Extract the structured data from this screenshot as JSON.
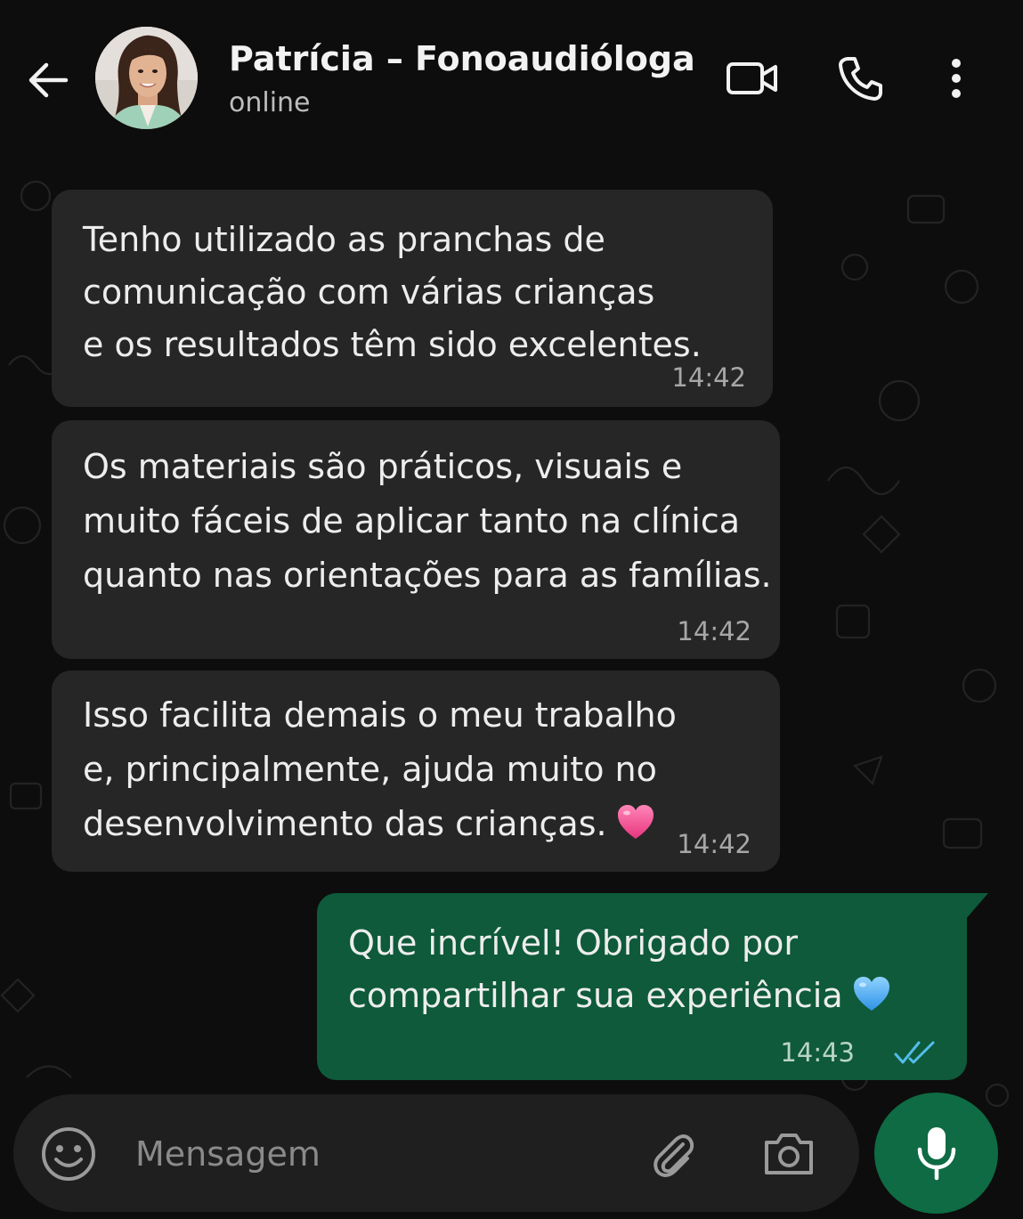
{
  "header": {
    "contact_name": "Patrícia – Fonoaudióloga",
    "status": "online",
    "icons": [
      "back-arrow-icon",
      "video-call-icon",
      "phone-icon",
      "more-vertical-icon"
    ]
  },
  "messages": [
    {
      "direction": "incoming",
      "lines": [
        "Tenho utilizado as pranchas de",
        "comunicação com várias crianças",
        "e os resultados têm sido excelentes."
      ],
      "time": "14:42"
    },
    {
      "direction": "incoming",
      "lines": [
        "Os materiais são práticos, visuais e",
        "muito fáceis de aplicar tanto na clínica",
        "quanto nas orientações para as famílias."
      ],
      "time": "14:42"
    },
    {
      "direction": "incoming",
      "lines": [
        "Isso facilita demais o meu trabalho",
        "e, principalmente, ajuda muito no",
        "desenvolvimento das crianças."
      ],
      "emoji": "pink-heart-emoji",
      "time": "14:42"
    },
    {
      "direction": "outgoing",
      "lines": [
        "Que incrível! Obrigado por",
        "compartilhar sua experiência"
      ],
      "emoji": "blue-heart-emoji",
      "time": "14:43",
      "read_status": "read"
    }
  ],
  "composer": {
    "placeholder": "Mensagem",
    "value": "",
    "icons": [
      "emoji-icon",
      "paperclip-icon",
      "camera-icon",
      "microphone-icon"
    ]
  },
  "colors": {
    "background": "#0d0d0d",
    "incoming_bubble": "#262626",
    "outgoing_bubble": "#0e5a3a",
    "mic_button": "#0e6b43",
    "read_ticks": "#53bdeb",
    "pink_heart": "#f45b9a",
    "blue_heart": "#5bb8f5"
  }
}
